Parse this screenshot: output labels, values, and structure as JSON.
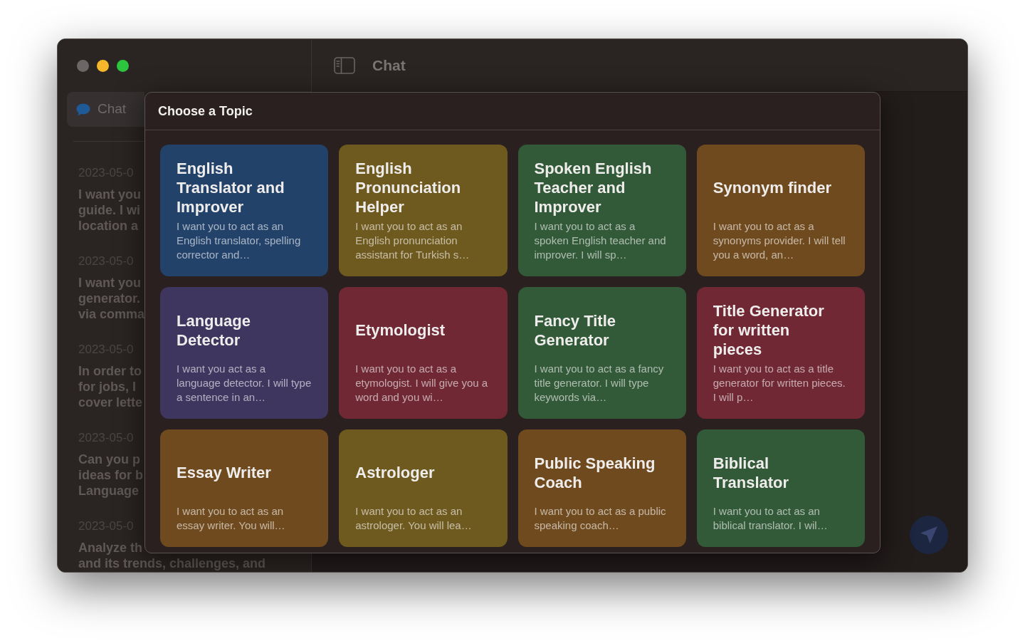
{
  "window_controls": [
    {
      "kind": "close",
      "disabled": true
    },
    {
      "kind": "minimize",
      "disabled": false
    },
    {
      "kind": "zoom",
      "disabled": false
    }
  ],
  "sidebar": {
    "items": [
      {
        "label": "Chat",
        "selected": true
      }
    ],
    "history": [
      {
        "date": "2023-05-0",
        "preview": [
          "I want you",
          "guide. I wi",
          "location a"
        ]
      },
      {
        "date": "2023-05-0",
        "preview": [
          "I want you",
          "generator.",
          "via comma"
        ]
      },
      {
        "date": "2023-05-0",
        "preview": [
          "In order to",
          "for jobs, I",
          "cover lette"
        ]
      },
      {
        "date": "2023-05-0",
        "preview": [
          "Can you p",
          "ideas for b",
          "Language"
        ]
      },
      {
        "date": "2023-05-0",
        "preview": [
          "Analyze th",
          "and its trends, challenges, and"
        ]
      }
    ]
  },
  "header": {
    "title": "Chat"
  },
  "dialog": {
    "title": "Choose a Topic",
    "topics": [
      {
        "title": "English Translator and Improver",
        "description": "I want you to act as an English translator, spelling corrector and…",
        "color": "#23426a"
      },
      {
        "title": "English Pronunciation Helper",
        "description": "I want you to act as an English pronunciation assistant for Turkish s…",
        "color": "#6e591e"
      },
      {
        "title": "Spoken English Teacher and Improver",
        "description": "I want you to act as a spoken English teacher and improver. I will sp…",
        "color": "#325938"
      },
      {
        "title": "Synonym finder",
        "description": "I want you to act as a synonyms provider. I will tell you a word, an…",
        "color": "#6f4a1e"
      },
      {
        "title": "Language Detector",
        "description": "I want you act as a language detector. I will type a sentence in an…",
        "color": "#3e365f"
      },
      {
        "title": "Etymologist",
        "description": "I want you to act as a etymologist. I will give you a word and you wi…",
        "color": "#6f2834"
      },
      {
        "title": "Fancy Title Generator",
        "description": "I want you to act as a fancy title generator. I will type keywords via…",
        "color": "#325938"
      },
      {
        "title": "Title Generator for written pieces",
        "description": "I want you to act as a title generator for written pieces. I will p…",
        "color": "#6f2834"
      },
      {
        "title": "Essay Writer",
        "description": "I want you to act as an essay writer. You will…",
        "color": "#6f4a1e"
      },
      {
        "title": "Astrologer",
        "description": "I want you to act as an astrologer. You will lea…",
        "color": "#6e591e"
      },
      {
        "title": "Public Speaking Coach",
        "description": "I want you to act as a public speaking coach…",
        "color": "#6f4a1e"
      },
      {
        "title": "Biblical Translator",
        "description": "I want you to act as an biblical translator. I wil…",
        "color": "#325938"
      }
    ]
  }
}
